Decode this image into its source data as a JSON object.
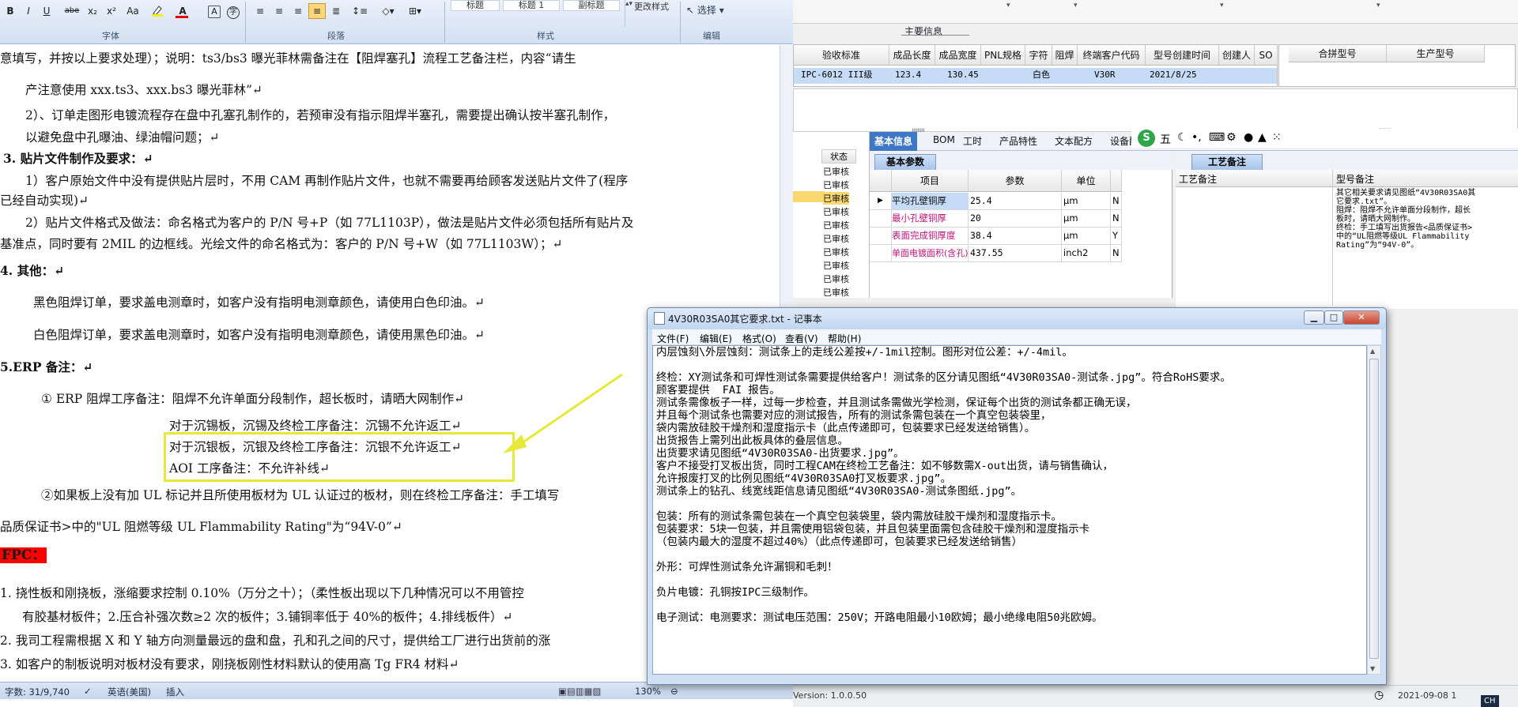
{
  "word": {
    "ribbon": {
      "groups": {
        "font": "字体",
        "paragraph": "段落",
        "styles": "样式",
        "editing": "编辑"
      },
      "font_buttons": [
        "B",
        "I",
        "U",
        "abe",
        "x₂",
        "x²",
        "Aa"
      ],
      "styles": [
        "标题",
        "标题 1",
        "副标题"
      ],
      "change_styles": "更改样式",
      "select": "选择"
    },
    "lines": [
      "意填写，并按以上要求处理）；说明：ts3/bs3 曝光菲林需备注在【阻焊塞孔】流程工艺备注栏，内容“请生",
      "产注意使用 xxx.ts3、xxx.bs3 曝光菲林”↵",
      "2）、订单走图形电镀流程存在盘中孔塞孔制作的，若预审没有指示阻焊半塞孔，需要提出确认按半塞孔制作，",
      "以避免盘中孔曝油、绿油帽问题；↵",
      "3. 贴片文件制作及要求：↵",
      "1）客户原始文件中没有提供贴片层时，不用 CAM 再制作贴片文件，也就不需要再给顾客发送贴片文件了(程序",
      "已经自动实现)↵",
      "2）贴片文件格式及做法：命名格式为客户的 P/N 号+P（如 77L1103P），做法是贴片文件必须包括所有贴片及",
      "基准点，同时要有 2MIL 的边框线。光绘文件的命名格式为：客户的  P/N 号+W（如 77L1103W）；↵",
      "4. 其他：↵",
      "黑色阻焊订单，要求盖电测章时，如客户没有指明电测章颜色，请使用白色印油。↵",
      "白色阻焊订单，要求盖电测章时，如客户没有指明电测章颜色，请使用黑色印油。↵",
      "5.ERP 备注：↵",
      "① ERP 阻焊工序备注：阻焊不允许单面分段制作，超长板时，请晒大网制作↵",
      "对于沉锡板，沉锡及终检工序备注：沉锡不允许返工↵",
      "对于沉银板，沉银及终检工序备注：沉银不允许返工↵",
      "AOI 工序备注：不允许补线↵",
      "②如果板上没有加 UL 标记并且所使用板材为 UL 认证过的板材，则在终检工序备注：手工填写",
      "品质保证书>中的\"UL 阻燃等级 UL Flammability Rating\"为“94V-0”↵",
      "FPC：",
      "1.   挠性板和刚挠板，涨缩要求控制 0.10%（万分之十）；（柔性板出现以下几种情况可以不用管控",
      "有胶基材板件；2.压合补强次数≥2 次的板件；3.铺铜率低于 40%的板件；4.排线板件）↵",
      "2.   我司工程需根据 X 和 Y 轴方向测量最远的盘和盘，孔和孔之间的尺寸，提供给工厂进行出货前的涨",
      "3. 如客户的制板说明对板材没有要求，刚挠板刚性材料默认的使用高 Tg FR4 材料↵"
    ],
    "status": {
      "words": "字数: 31/9,740",
      "language": "英语(美国)",
      "mode": "插入",
      "zoom": "130%"
    }
  },
  "erp": {
    "section_title": "主要信息",
    "top_headers": [
      "验收标准",
      "成品长度",
      "成品宽度",
      "PNL规格",
      "字符",
      "阻焊",
      "终端客户代码",
      "型号创建时间",
      "创建人",
      "SO"
    ],
    "top_row": [
      "IPC-6012 III级",
      "123.4",
      "130.45",
      "",
      "白色",
      "",
      "V30R",
      "2021/8/25",
      "",
      ""
    ],
    "right_headers": [
      "合拼型号",
      "生产型号"
    ],
    "tabs": [
      "基本信息",
      "BOM",
      "工时",
      "产品特性",
      "文本配方",
      "设备配方"
    ],
    "status_header": "状态",
    "status_items": [
      "已审核",
      "已审核",
      "已审核",
      "已审核",
      "已审核",
      "已审核",
      "已审核",
      "已审核",
      "已审核",
      "已审核"
    ],
    "basic_params_tab": "基本参数",
    "param_headers": [
      "项目",
      "参数",
      "单位",
      ""
    ],
    "params": [
      {
        "item": "平均孔壁铜厚",
        "value": "25.4",
        "unit": "μm",
        "flag": "N"
      },
      {
        "item": "最小孔壁铜厚",
        "value": "20",
        "unit": "μm",
        "flag": "N"
      },
      {
        "item": "表面完成铜厚度",
        "value": "38.4",
        "unit": "μm",
        "flag": "Y"
      },
      {
        "item": "单面电镀面积(含孔)",
        "value": "437.55",
        "unit": "inch2",
        "flag": "N"
      }
    ],
    "process_tab": "工艺备注",
    "process_header": "工艺备注",
    "model_header": "型号备注",
    "model_note": [
      "其它相关要求请见图纸“4V30R03SA0其",
      "它要求.txt”。",
      "阻焊：阻焊不允许单面分段制作，超长",
      "板时，请晒大网制作。",
      "终检：手工填写出货报告<品质保证书>",
      "中的“UL阻燃等级UL Flammability",
      "Rating”为“94V-0”。"
    ],
    "ime": "五",
    "version": "Version: 1.0.0.50",
    "datetime": "2021-09-08 1",
    "lang_indicator": "CH"
  },
  "notepad": {
    "title": "4V30R03SA0其它要求.txt - 记事本",
    "menu": [
      "文件(F)",
      "编辑(E)",
      "格式(O)",
      "查看(V)",
      "帮助(H)"
    ],
    "lines": [
      "内层蚀刻\\外层蚀刻：测试条上的走线公差按+/-1mil控制。图形对位公差：+/-4mil。",
      "",
      "终检：XY测试条和可焊性测试条需要提供给客户！测试条的区分请见图纸“4V30R03SA0-测试条.jpg”。符合RoHS要求。",
      "顾客要提供  FAI 报告。",
      "测试条需像板子一样，过每一步检查，并且测试条需做光学检测，保证每个出货的测试条都正确无误，",
      "并且每个测试条也需要对应的测试报告，所有的测试条需包装在一个真空包装袋里，",
      "袋内需放硅胶干燥剂和湿度指示卡（此点传递即可，包装要求已经发送给销售）。",
      "出货报告上需列出此板具体的叠层信息。",
      "出货要求请见图纸“4V30R03SA0-出货要求.jpg”。",
      "客户不接受打叉板出货，同时工程CAM在终检工艺备注：如不够数需X-out出货，请与销售确认，",
      "允许报废打叉的比例见图纸“4V30R03SA0打叉板要求.jpg”。",
      "测试条上的钻孔、线宽线距信息请见图纸“4V30R03SA0-测试条图纸.jpg”。",
      "",
      "包装：所有的测试条需包装在一个真空包装袋里，袋内需放硅胶干燥剂和湿度指示卡。",
      "包装要求：5块一包装，并且需使用铝袋包装，并且包装里面需包含硅胶干燥剂和湿度指示卡",
      "（包装内最大的湿度不超过40%）（此点传递即可，包装要求已经发送给销售）",
      "",
      "外形：可焊性测试条允许漏铜和毛刺！",
      "",
      "负片电镀：孔铜按IPC三级制作。",
      "",
      "电子测试：电测要求：测试电压范围：250V；开路电阻最小10欧姆；最小绝缘电阻50兆欧姆。"
    ]
  }
}
